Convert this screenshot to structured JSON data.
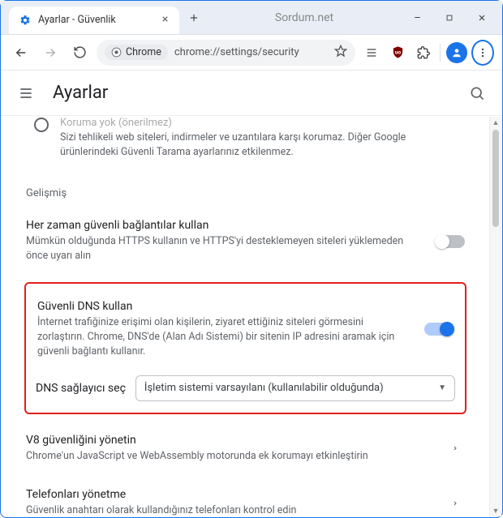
{
  "window": {
    "tab_title": "Ayarlar - Güvenlik",
    "site_label": "Sordum.net"
  },
  "toolbar": {
    "chip_label": "Chrome",
    "url": "chrome://settings/security"
  },
  "header": {
    "title": "Ayarlar"
  },
  "safe_browsing_none": {
    "title": "Koruma yok (önerilmez)",
    "desc": "Sizi tehlikeli web siteleri, indirmeler ve uzantılara karşı korumaz. Diğer Google ürünlerindeki Güvenli Tarama ayarlarınız etkilenmez."
  },
  "advanced_label": "Gelişmiş",
  "https": {
    "title": "Her zaman güvenli bağlantılar kullan",
    "desc": "Mümkün olduğunda HTTPS kullanın ve HTTPS'yi desteklemeyen siteleri yüklemeden önce uyarı alın"
  },
  "dns": {
    "title": "Güvenli DNS kullan",
    "desc": "İnternet trafiğinize erişimi olan kişilerin, ziyaret ettiğiniz siteleri görmesini zorlaştırın. Chrome, DNS'de (Alan Adı Sistemi) bir sitenin IP adresini aramak için güvenli bağlantı kullanır.",
    "provider_label": "DNS sağlayıcı seç",
    "provider_value": "İşletim sistemi varsayılanı (kullanılabilir olduğunda)"
  },
  "v8": {
    "title": "V8 güvenliğini yönetin",
    "desc": "Chrome'un JavaScript ve WebAssembly motorunda ek korumayı etkinleştirin"
  },
  "phones": {
    "title": "Telefonları yönetme",
    "desc": "Güvenlik anahtarı olarak kullandığınız telefonları kontrol edin"
  }
}
